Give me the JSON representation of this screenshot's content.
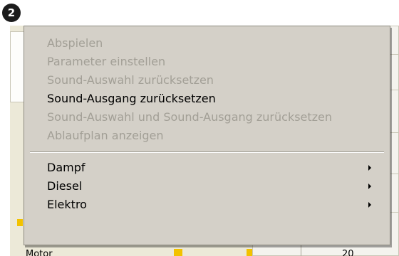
{
  "badge": {
    "number": "2"
  },
  "background": {
    "row_label": "Motor",
    "row_value": "20"
  },
  "context_menu": {
    "items": [
      {
        "label": "Abspielen",
        "enabled": false
      },
      {
        "label": "Parameter einstellen",
        "enabled": false
      },
      {
        "label": "Sound-Auswahl zurücksetzen",
        "enabled": false
      },
      {
        "label": "Sound-Ausgang zurücksetzen",
        "enabled": true
      },
      {
        "label": "Sound-Auswahl und Sound-Ausgang zurücksetzen",
        "enabled": false
      },
      {
        "label": "Ablaufplan anzeigen",
        "enabled": false
      }
    ],
    "submenus": [
      {
        "label": "Dampf",
        "icon": "chevron-right-icon"
      },
      {
        "label": "Diesel",
        "icon": "chevron-right-icon"
      },
      {
        "label": "Elektro",
        "icon": "chevron-right-icon"
      }
    ]
  }
}
